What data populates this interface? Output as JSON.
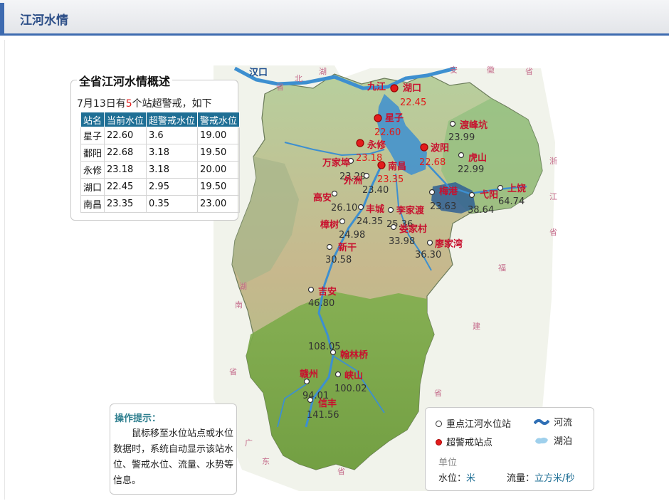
{
  "header": {
    "title": "江河水情"
  },
  "overview": {
    "title": "全省江河水情概述",
    "summary_prefix": "7月13日有",
    "summary_count": "5",
    "summary_suffix": "个站超警戒，如下",
    "columns": [
      "站名",
      "当前水位",
      "超警戒水位",
      "警戒水位"
    ],
    "rows": [
      [
        "星子",
        "22.60",
        "3.6",
        "19.00"
      ],
      [
        "鄱阳",
        "22.68",
        "3.18",
        "19.50"
      ],
      [
        "永修",
        "23.18",
        "3.18",
        "20.00"
      ],
      [
        "湖口",
        "22.45",
        "2.95",
        "19.50"
      ],
      [
        "南昌",
        "23.35",
        "0.35",
        "23.00"
      ]
    ]
  },
  "hint": {
    "title": "操作提示：",
    "text": "鼠标移至水位站点或水位数据时，系统自动显示该站水位、警戒水位、流量、水势等信息。"
  },
  "legend": {
    "station": "重点江河水位站",
    "alert": "超警戒站点",
    "river": "河流",
    "lake": "湖泊",
    "unit_title": "单位",
    "level_label": "水位：",
    "level_unit": "米",
    "flow_label": "流量：",
    "flow_unit": "立方米/秒"
  },
  "map_labels": {
    "hankou": "汉口",
    "provinces": [
      "安",
      "徽",
      "省",
      "浙",
      "江",
      "省",
      "福",
      "建",
      "省",
      "广",
      "东",
      "省",
      "湖",
      "南",
      "省",
      "湖",
      "北",
      "省"
    ]
  },
  "stations": [
    {
      "name": "湖口",
      "value": "22.45",
      "alert": true
    },
    {
      "name": "九江",
      "value": "",
      "alert": false
    },
    {
      "name": "星子",
      "value": "22.60",
      "alert": true
    },
    {
      "name": "永修",
      "value": "23.18",
      "alert": true
    },
    {
      "name": "波阳",
      "value": "22.68",
      "alert": true
    },
    {
      "name": "南昌",
      "value": "23.35",
      "alert": true
    },
    {
      "name": "渡峰坑",
      "value": "23.99",
      "alert": false
    },
    {
      "name": "虎山",
      "value": "22.99",
      "alert": false
    },
    {
      "name": "万家埠",
      "value": "23.29",
      "alert": false
    },
    {
      "name": "外洲",
      "value": "23.40",
      "alert": false
    },
    {
      "name": "梅港",
      "value": "23.63",
      "alert": false
    },
    {
      "name": "弋阳",
      "value": "38.64",
      "alert": false
    },
    {
      "name": "上饶",
      "value": "64.74",
      "alert": false
    },
    {
      "name": "高安",
      "value": "26.10",
      "alert": false
    },
    {
      "name": "丰城",
      "value": "24.35",
      "alert": false
    },
    {
      "name": "李家渡",
      "value": "25.36",
      "alert": false
    },
    {
      "name": "娄家村",
      "value": "33.98",
      "alert": false
    },
    {
      "name": "樟树",
      "value": "24.98",
      "alert": false
    },
    {
      "name": "廖家湾",
      "value": "36.30",
      "alert": false
    },
    {
      "name": "新干",
      "value": "30.58",
      "alert": false
    },
    {
      "name": "吉安",
      "value": "46.80",
      "alert": false
    },
    {
      "name": "翰林桥",
      "value": "108.05",
      "alert": false
    },
    {
      "name": "峡山",
      "value": "100.02",
      "alert": false
    },
    {
      "name": "赣州",
      "value": "94.01",
      "alert": false
    },
    {
      "name": "信丰",
      "value": "141.56",
      "alert": false
    }
  ]
}
